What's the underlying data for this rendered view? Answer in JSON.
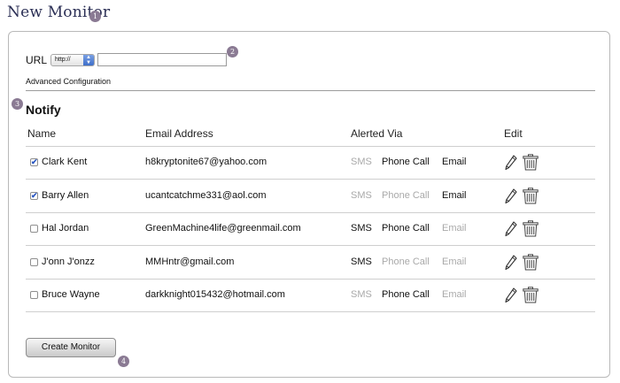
{
  "page": {
    "title": "New Monitor"
  },
  "callouts": [
    "1",
    "2",
    "3",
    "4"
  ],
  "url": {
    "label": "URL",
    "protocol": "http://",
    "value": ""
  },
  "advanced_link": "Advanced Configuration",
  "notify": {
    "title": "Notify",
    "columns": {
      "name": "Name",
      "email": "Email Address",
      "alerted": "Alerted Via",
      "edit": "Edit"
    },
    "rows": [
      {
        "checked": true,
        "name": "Clark Kent",
        "email": "h8kryptonite67@yahoo.com",
        "sms": "SMS",
        "phone": "Phone Call",
        "mail": "Email",
        "sms_on": false,
        "phone_on": true,
        "mail_on": true
      },
      {
        "checked": true,
        "name": "Barry Allen",
        "email": "ucantcatchme331@aol.com",
        "sms": "SMS",
        "phone": "Phone Call",
        "mail": "Email",
        "sms_on": false,
        "phone_on": false,
        "mail_on": true
      },
      {
        "checked": false,
        "name": "Hal Jordan",
        "email": "GreenMachine4life@greenmail.com",
        "sms": "SMS",
        "phone": "Phone Call",
        "mail": "Email",
        "sms_on": true,
        "phone_on": true,
        "mail_on": false
      },
      {
        "checked": false,
        "name": "J'onn J'onzz",
        "email": "MMHntr@gmail.com",
        "sms": "SMS",
        "phone": "Phone Call",
        "mail": "Email",
        "sms_on": true,
        "phone_on": false,
        "mail_on": false
      },
      {
        "checked": false,
        "name": "Bruce Wayne",
        "email": "darkknight015432@hotmail.com",
        "sms": "SMS",
        "phone": "Phone Call",
        "mail": "Email",
        "sms_on": false,
        "phone_on": true,
        "mail_on": false
      }
    ]
  },
  "create_button": "Create Monitor",
  "colors": {
    "title": "#2b2f55",
    "callout": "#8a7a93",
    "active": "#111111",
    "inactive": "#a9a9a9"
  },
  "icons": {
    "check": "checkmark-icon",
    "edit": "pencil-icon",
    "delete": "trash-icon"
  }
}
